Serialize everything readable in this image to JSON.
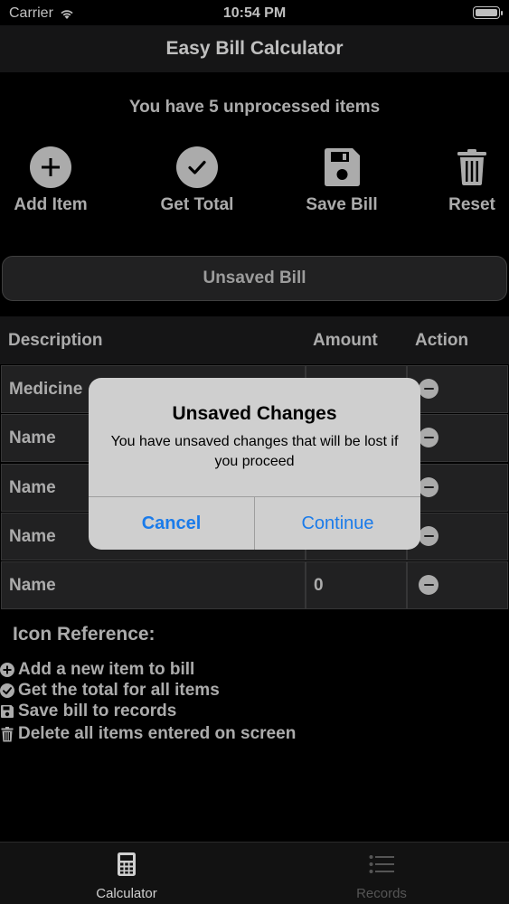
{
  "status_bar": {
    "carrier": "Carrier",
    "time": "10:54 PM"
  },
  "nav": {
    "title": "Easy Bill Calculator"
  },
  "summary": {
    "text": "You have 5 unprocessed items"
  },
  "actions": [
    {
      "label": "Add Item",
      "icon": "plus-circle-icon"
    },
    {
      "label": "Get Total",
      "icon": "checkmark-circle-icon"
    },
    {
      "label": "Save Bill",
      "icon": "floppy-disk-icon"
    },
    {
      "label": "Reset",
      "icon": "trash-icon"
    }
  ],
  "bill": {
    "header": "Unsaved Bill"
  },
  "table": {
    "columns": [
      "Description",
      "Amount",
      "Action"
    ],
    "rows": [
      {
        "description": "Medicine",
        "amount": ""
      },
      {
        "description": "Name",
        "amount": ""
      },
      {
        "description": "Name",
        "amount": ""
      },
      {
        "description": "Name",
        "amount": ""
      },
      {
        "description": "Name",
        "amount": "0"
      }
    ]
  },
  "reference": {
    "title": "Icon Reference:",
    "items": [
      {
        "icon": "plus-circle-icon",
        "text": "Add a new item to bill"
      },
      {
        "icon": "checkmark-circle-icon",
        "text": "Get the total for all items"
      },
      {
        "icon": "floppy-disk-icon",
        "text": "Save bill to records"
      },
      {
        "icon": "trash-icon",
        "text": "Delete all items entered on screen"
      }
    ]
  },
  "alert": {
    "title": "Unsaved Changes",
    "message": "You have unsaved changes that will be lost if you proceed",
    "cancel": "Cancel",
    "continue": "Continue"
  },
  "tabs": [
    {
      "label": "Calculator",
      "icon": "calculator-icon",
      "active": true
    },
    {
      "label": "Records",
      "icon": "list-icon",
      "active": false
    }
  ],
  "colors": {
    "accent": "#1a7bea",
    "background": "#000000",
    "cell": "#2c2c2e"
  }
}
